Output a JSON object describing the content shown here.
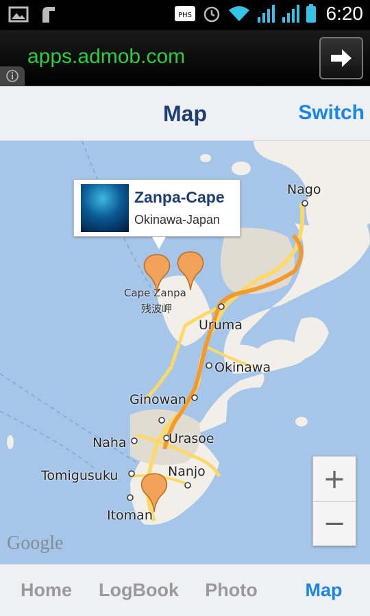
{
  "status_bar": {
    "time": "6:20",
    "icons": [
      "gallery-icon",
      "usb-icon",
      "phs-icon",
      "alarm-icon",
      "wifi-icon",
      "signal-icon",
      "signal-icon",
      "battery-icon"
    ],
    "phs_label": "PHS"
  },
  "ad": {
    "text": "apps.admob.com",
    "info_icon": "info-icon",
    "open_icon": "arrow-right-icon",
    "text_color": "#2ecc40"
  },
  "header": {
    "title": "Map",
    "switch_label": "Switch"
  },
  "map": {
    "bubble": {
      "title": "Zanpa-Cape",
      "subtitle": "Okinawa-Japan"
    },
    "cities": {
      "nago": "Nago",
      "uruma": "Uruma",
      "okinawa": "Okinawa",
      "ginowan": "Ginowan",
      "naha": "Naha",
      "urasoe": "Urasoe",
      "tomigusuku": "Tomigusuku",
      "nanjo": "Nanjo",
      "itoman": "Itoman"
    },
    "poi": {
      "cape_zanpa": "Cape Zanpa",
      "cape_zanpa_jp": "残波岬"
    },
    "zoom_in": "+",
    "zoom_out": "−",
    "logo": "Google",
    "colors": {
      "water": "#a5c6e9",
      "land": "#f1efe8",
      "urban": "#e0dcd2",
      "highway": "#f29a2e",
      "road": "#fdd86a",
      "pin": "#f2a35a"
    }
  },
  "tabs": {
    "items": [
      {
        "label": "Home"
      },
      {
        "label": "LogBook"
      },
      {
        "label": "Photo"
      },
      {
        "label": "Map"
      }
    ],
    "active": "Map",
    "active_color": "#1a86e6"
  }
}
